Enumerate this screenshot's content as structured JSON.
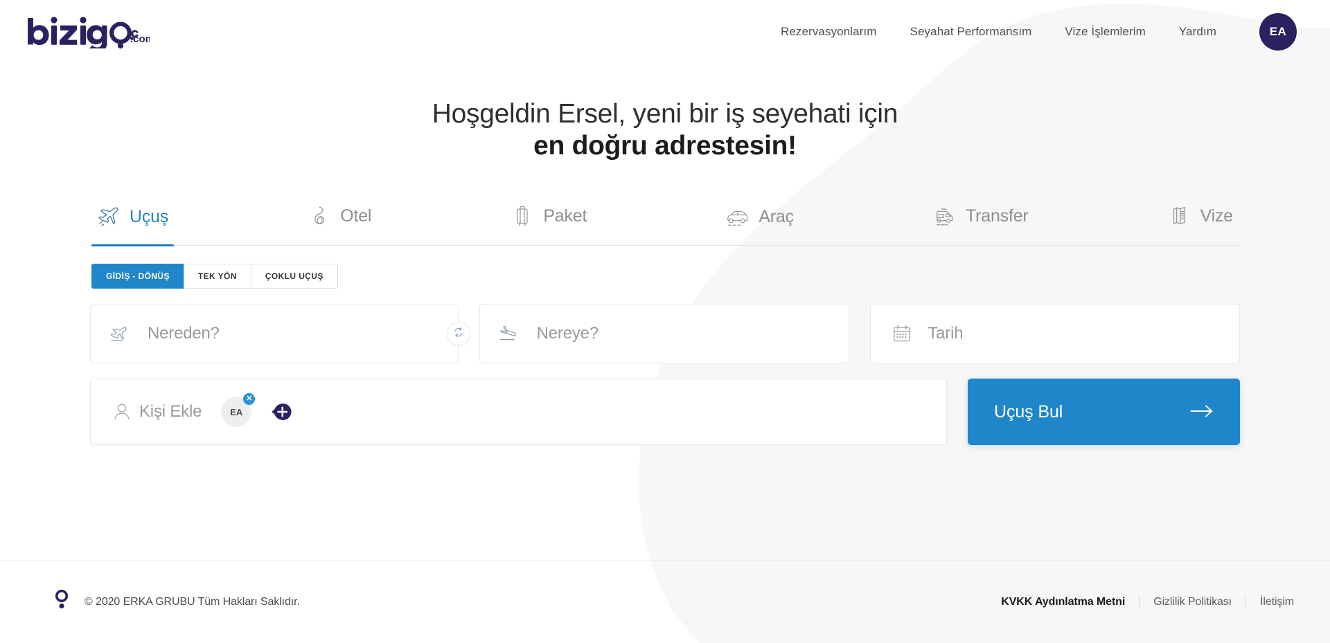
{
  "brand": {
    "logo_text": "bizigo",
    "logo_suffix": ".com",
    "navy": "#2b2160",
    "blue": "#1e86c9"
  },
  "header": {
    "nav": [
      {
        "label": "Rezervasyonlarım",
        "name": "nav-rezervasyonlarim"
      },
      {
        "label": "Seyahat Performansım",
        "name": "nav-seyahat-performansim"
      },
      {
        "label": "Vize İşlemlerim",
        "name": "nav-vize-islemlerim"
      },
      {
        "label": "Yardım",
        "name": "nav-yardim"
      }
    ],
    "avatar_initials": "EA"
  },
  "hero": {
    "line1": "Hoşgeldin Ersel, yeni bir iş seyehati için",
    "line2": "en doğru adrestesin!"
  },
  "tabs": [
    {
      "label": "Uçuş",
      "icon": "plane-icon",
      "active": true
    },
    {
      "label": "Otel",
      "icon": "hotel-icon",
      "active": false
    },
    {
      "label": "Paket",
      "icon": "luggage-icon",
      "active": false
    },
    {
      "label": "Araç",
      "icon": "car-icon",
      "active": false
    },
    {
      "label": "Transfer",
      "icon": "van-icon",
      "active": false
    },
    {
      "label": "Vize",
      "icon": "documents-icon",
      "active": false
    }
  ],
  "trip_types": [
    {
      "label": "GİDİŞ - DÖNÜŞ",
      "active": true
    },
    {
      "label": "TEK YÖN",
      "active": false
    },
    {
      "label": "ÇOKLU UÇUŞ",
      "active": false
    }
  ],
  "search_form": {
    "origin": {
      "placeholder": "Nereden?",
      "value": "",
      "icon": "plane-takeoff-icon"
    },
    "destination": {
      "placeholder": "Nereye?",
      "value": "",
      "icon": "plane-landing-icon"
    },
    "date": {
      "placeholder": "Tarih",
      "value": "",
      "icon": "calendar-icon"
    },
    "swap_icon": "swap-icon",
    "passenger": {
      "placeholder": "Kişi Ekle",
      "icon": "person-icon",
      "chips": [
        {
          "initials": "EA",
          "remove_label": "✕"
        }
      ],
      "add_label": "+"
    },
    "submit": {
      "label": "Uçuş Bul",
      "icon": "arrow-right-icon"
    }
  },
  "footer": {
    "copyright": "© 2020 ERKA GRUBU Tüm Hakları Saklıdır.",
    "links": [
      {
        "label": "KVKK Aydınlatma Metni",
        "strong": true
      },
      {
        "label": "Gizlilik Politikası",
        "strong": false
      },
      {
        "label": "İletişim",
        "strong": false
      }
    ]
  }
}
